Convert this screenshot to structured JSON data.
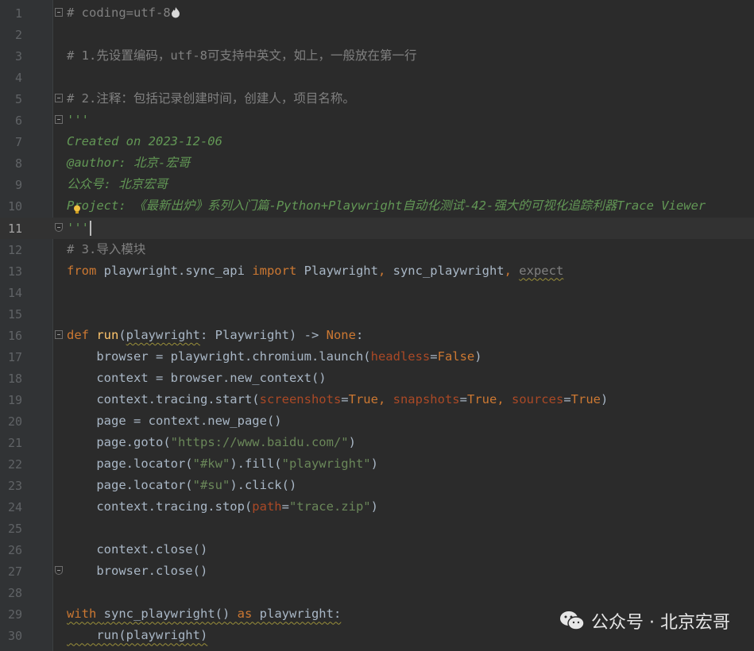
{
  "editor": {
    "current_line": 11,
    "lines": [
      {
        "n": "1",
        "segs": [
          [
            "comment",
            "# coding=utf-8"
          ]
        ],
        "fold": "start",
        "flame": true
      },
      {
        "n": "2",
        "segs": []
      },
      {
        "n": "3",
        "segs": [
          [
            "comment",
            "# 1.先设置编码，utf-8可支持中英文，如上，一般放在第一行"
          ]
        ]
      },
      {
        "n": "4",
        "segs": []
      },
      {
        "n": "5",
        "segs": [
          [
            "comment",
            "# 2.注释：包括记录创建时间，创建人，项目名称。"
          ]
        ],
        "fold": "start"
      },
      {
        "n": "6",
        "segs": [
          [
            "doc",
            "'''"
          ]
        ],
        "fold": "start"
      },
      {
        "n": "7",
        "segs": [
          [
            "doc",
            "Created on 2023-12-06"
          ]
        ]
      },
      {
        "n": "8",
        "segs": [
          [
            "doc",
            "@author: 北京-宏哥"
          ]
        ]
      },
      {
        "n": "9",
        "segs": [
          [
            "doc",
            "公众号: 北京宏哥"
          ]
        ]
      },
      {
        "n": "10",
        "segs": [
          [
            "doc",
            "Project: 《最新出炉》系列入门篇-Python+Playwright自动化测试-42-强大的可视化追踪利器Trace Viewer"
          ]
        ]
      },
      {
        "n": "11",
        "segs": [
          [
            "doc",
            "'''"
          ]
        ],
        "fold": "end",
        "cursor": true
      },
      {
        "n": "12",
        "segs": [
          [
            "comment",
            "# 3.导入模块"
          ]
        ]
      },
      {
        "n": "13",
        "segs": [
          [
            "kw",
            "from "
          ],
          [
            "plain",
            "playwright.sync_api "
          ],
          [
            "kw",
            "import "
          ],
          [
            "plain",
            "Playwright"
          ],
          [
            "kw",
            ", "
          ],
          [
            "plain",
            "sync_playwright"
          ],
          [
            "kw",
            ", "
          ],
          [
            "dimwavy",
            "expect"
          ]
        ]
      },
      {
        "n": "14",
        "segs": []
      },
      {
        "n": "15",
        "segs": []
      },
      {
        "n": "16",
        "segs": [
          [
            "kw",
            "def "
          ],
          [
            "fn",
            "run"
          ],
          [
            "plain",
            "("
          ],
          [
            "wavy",
            "playwright"
          ],
          [
            "plain",
            ": Playwright) -> "
          ],
          [
            "kw",
            "None"
          ],
          [
            "plain",
            ":"
          ]
        ],
        "fold": "start"
      },
      {
        "n": "17",
        "segs": [
          [
            "plain",
            "    browser = playwright.chromium.launch("
          ],
          [
            "param",
            "headless"
          ],
          [
            "plain",
            "="
          ],
          [
            "kw",
            "False"
          ],
          [
            "plain",
            ")"
          ]
        ]
      },
      {
        "n": "18",
        "segs": [
          [
            "plain",
            "    context = browser.new_context()"
          ]
        ]
      },
      {
        "n": "19",
        "segs": [
          [
            "plain",
            "    context.tracing.start("
          ],
          [
            "param",
            "screenshots"
          ],
          [
            "plain",
            "="
          ],
          [
            "kw",
            "True"
          ],
          [
            "kw",
            ", "
          ],
          [
            "param",
            "snapshots"
          ],
          [
            "plain",
            "="
          ],
          [
            "kw",
            "True"
          ],
          [
            "kw",
            ", "
          ],
          [
            "param",
            "sources"
          ],
          [
            "plain",
            "="
          ],
          [
            "kw",
            "True"
          ],
          [
            "plain",
            ")"
          ]
        ]
      },
      {
        "n": "20",
        "segs": [
          [
            "plain",
            "    page = context.new_page()"
          ]
        ]
      },
      {
        "n": "21",
        "segs": [
          [
            "plain",
            "    page.goto("
          ],
          [
            "str",
            "\"https://www.baidu.com/\""
          ],
          [
            "plain",
            ")"
          ]
        ]
      },
      {
        "n": "22",
        "segs": [
          [
            "plain",
            "    page.locator("
          ],
          [
            "str",
            "\"#kw\""
          ],
          [
            "plain",
            ").fill("
          ],
          [
            "str",
            "\"playwright\""
          ],
          [
            "plain",
            ")"
          ]
        ]
      },
      {
        "n": "23",
        "segs": [
          [
            "plain",
            "    page.locator("
          ],
          [
            "str",
            "\"#su\""
          ],
          [
            "plain",
            ").click()"
          ]
        ]
      },
      {
        "n": "24",
        "segs": [
          [
            "plain",
            "    context.tracing.stop("
          ],
          [
            "param",
            "path"
          ],
          [
            "plain",
            "="
          ],
          [
            "str",
            "\"trace.zip\""
          ],
          [
            "plain",
            ")"
          ]
        ]
      },
      {
        "n": "25",
        "segs": []
      },
      {
        "n": "26",
        "segs": [
          [
            "plain",
            "    context.close()"
          ]
        ]
      },
      {
        "n": "27",
        "segs": [
          [
            "plain",
            "    browser.close()"
          ]
        ],
        "fold": "end"
      },
      {
        "n": "28",
        "segs": []
      },
      {
        "n": "29",
        "segs": [
          [
            "kwwavy",
            "with "
          ],
          [
            "wavy",
            "sync_playwright() "
          ],
          [
            "kwwavy",
            "as "
          ],
          [
            "wavy",
            "playwright:"
          ]
        ]
      },
      {
        "n": "30",
        "segs": [
          [
            "wavy",
            "    run(playwright)"
          ]
        ]
      }
    ]
  },
  "watermark": {
    "label": "公众号 · 北京宏哥",
    "icon": "wechat-icon"
  },
  "colors": {
    "background": "#2b2b2b",
    "comment": "#808080",
    "docstring": "#629755",
    "keyword": "#cc7832",
    "string": "#6a8759",
    "parameter": "#aa4926",
    "function": "#ffc66d",
    "text": "#a9b7c6"
  }
}
